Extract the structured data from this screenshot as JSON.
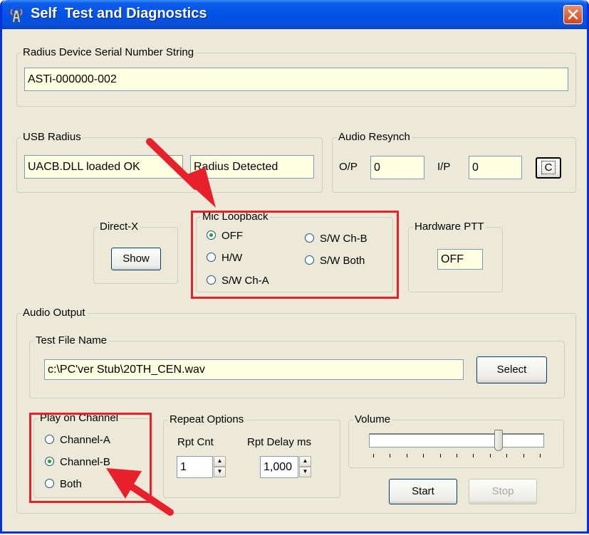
{
  "window": {
    "title": "Self  Test and Diagnostics"
  },
  "serial": {
    "group_label": "Radius Device Serial Number String",
    "value": "ASTi-000000-002"
  },
  "usb_radius": {
    "group_label": "USB Radius",
    "dll_status": "UACB.DLL loaded OK",
    "detect_status": "Radius Detected"
  },
  "audio_resynch": {
    "group_label": "Audio Resynch",
    "op_label": "O/P",
    "op_value": "0",
    "ip_label": "I/P",
    "ip_value": "0",
    "clear_label": "C"
  },
  "directx": {
    "group_label": "Direct-X",
    "show_label": "Show"
  },
  "mic_loopback": {
    "group_label": "Mic Loopback",
    "options": [
      "OFF",
      "H/W",
      "S/W Ch-A",
      "S/W Ch-B",
      "S/W Both"
    ],
    "selected": "OFF"
  },
  "hardware_ptt": {
    "group_label": "Hardware PTT",
    "value": "OFF"
  },
  "audio_output": {
    "group_label": "Audio Output",
    "test_file": {
      "group_label": "Test File Name",
      "value": "c:\\PC'ver Stub\\20TH_CEN.wav",
      "select_label": "Select"
    },
    "play_on_channel": {
      "group_label": "Play on Channel",
      "options": [
        "Channel-A",
        "Channel-B",
        "Both"
      ],
      "selected": "Channel-B"
    },
    "repeat_options": {
      "group_label": "Repeat Options",
      "rpt_cnt_label": "Rpt Cnt",
      "rpt_cnt_value": "1",
      "rpt_delay_label": "Rpt Delay ms",
      "rpt_delay_value": "1,000"
    },
    "volume": {
      "group_label": "Volume",
      "level": 0.75
    },
    "start_label": "Start",
    "stop_label": "Stop"
  },
  "colors": {
    "title_bar": "#0053e6",
    "dialog_bg": "#ece9d8",
    "field_bg": "#ffffe1",
    "highlight": "#e8202b",
    "close_button": "#d2441a"
  },
  "icons": {
    "title": "radio-tower-icon",
    "close": "close-icon",
    "annotation": "red-arrow-icon"
  }
}
